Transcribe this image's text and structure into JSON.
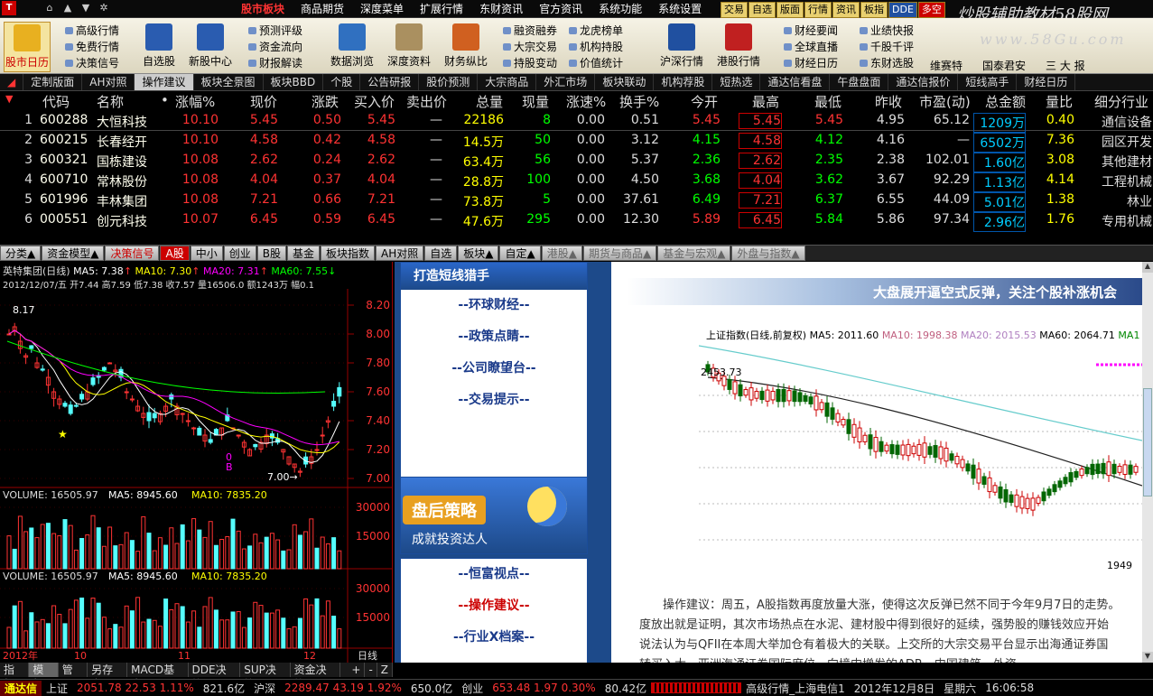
{
  "titlebar": {
    "nav_icons": [
      "home-icon",
      "up-arrow-icon",
      "down-arrow-icon",
      "star-icon"
    ],
    "menu": [
      "股市板块",
      "商品期货",
      "深度菜单",
      "扩展行情",
      "东财资讯",
      "官方资讯",
      "系统功能",
      "系统设置"
    ],
    "quick": [
      "交易",
      "自选",
      "版面",
      "行情",
      "资讯",
      "板指",
      "DDE",
      "多空"
    ],
    "watermark": "炒股辅助教材58股网",
    "watermark2": "www.58Gu.com"
  },
  "toolbar": {
    "big": [
      {
        "label": "股市日历",
        "icon": "calendar-icon",
        "color": "#e8b020"
      },
      {
        "label": "自选股",
        "icon": "chart-icon",
        "color": "#2a5cb0"
      },
      {
        "label": "新股中心",
        "icon": "chart-icon",
        "color": "#2a5cb0"
      },
      {
        "label": "数据浏览",
        "icon": "monitor-icon",
        "color": "#3070c0"
      },
      {
        "label": "深度资料",
        "icon": "document-icon",
        "color": "#aa9060"
      },
      {
        "label": "财务纵比",
        "icon": "bar-chart-icon",
        "color": "#d06020"
      },
      {
        "label": "沪深行情",
        "icon": "flag-icon",
        "color": "#2050a0"
      },
      {
        "label": "港股行情",
        "icon": "flag-icon",
        "color": "#c02020"
      }
    ],
    "col1": [
      "高级行情",
      "免费行情",
      "决策信号"
    ],
    "col2": [
      "预测评级",
      "资金流向",
      "财报解读"
    ],
    "col3": [
      "融资融券",
      "大宗交易",
      "持股变动"
    ],
    "col4": [
      "龙虎榜单",
      "机构持股",
      "价值统计"
    ],
    "col5": [
      "财经要闻",
      "全球直播",
      "财经日历"
    ],
    "col6": [
      "业绩快报",
      "千股千评",
      "东财选股"
    ],
    "right": [
      "维赛特",
      "国泰君安",
      "三 大 报"
    ]
  },
  "cattabs": [
    "定制版面",
    "AH对照",
    "操作建议",
    "板块全景图",
    "板块BBD",
    "个股",
    "公告研报",
    "股价预测",
    "大宗商品",
    "外汇市场",
    "板块联动",
    "机构荐股",
    "短热选",
    "通达信看盘",
    "午盘盘面",
    "通达信报价",
    "短线高手",
    "财经日历"
  ],
  "quotes": {
    "headers": [
      "代码",
      "名称",
      "•",
      "涨幅%",
      "现价",
      "涨跌",
      "买入价",
      "卖出价",
      "总量",
      "现量",
      "涨速%",
      "换手%",
      "今开",
      "最高",
      "最低",
      "昨收",
      "市盈(动)",
      "总金额",
      "量比",
      "细分行业"
    ],
    "rows": [
      {
        "idx": "1",
        "code": "600288",
        "name": "大恒科技",
        "rate": "10.10",
        "price": "5.45",
        "chg": "0.50",
        "bid": "5.45",
        "ask": "—",
        "vol": "22186",
        "cur": "8",
        "spd": "0.00",
        "turn": "0.51",
        "open": "5.45",
        "open_color": "#f33",
        "high": "5.45",
        "low": "5.45",
        "low_color": "#f33",
        "prev": "4.95",
        "pe": "65.12",
        "amt": "1209万",
        "ratio": "0.40",
        "ind": "通信设备"
      },
      {
        "idx": "2",
        "code": "600215",
        "name": "长春经开",
        "rate": "10.10",
        "price": "4.58",
        "chg": "0.42",
        "bid": "4.58",
        "ask": "—",
        "vol": "14.5万",
        "cur": "50",
        "spd": "0.00",
        "turn": "3.12",
        "open": "4.15",
        "open_color": "#0f0",
        "high": "4.58",
        "low": "4.12",
        "low_color": "#0f0",
        "prev": "4.16",
        "pe": "—",
        "amt": "6502万",
        "ratio": "7.36",
        "ind": "园区开发"
      },
      {
        "idx": "3",
        "code": "600321",
        "name": "国栋建设",
        "rate": "10.08",
        "price": "2.62",
        "chg": "0.24",
        "bid": "2.62",
        "ask": "—",
        "vol": "63.4万",
        "cur": "56",
        "spd": "0.00",
        "turn": "5.37",
        "open": "2.36",
        "open_color": "#0f0",
        "high": "2.62",
        "low": "2.35",
        "low_color": "#0f0",
        "prev": "2.38",
        "pe": "102.01",
        "amt": "1.60亿",
        "ratio": "3.08",
        "ind": "其他建材"
      },
      {
        "idx": "4",
        "code": "600710",
        "name": "常林股份",
        "rate": "10.08",
        "price": "4.04",
        "chg": "0.37",
        "bid": "4.04",
        "ask": "—",
        "vol": "28.8万",
        "cur": "100",
        "spd": "0.00",
        "turn": "4.50",
        "open": "3.68",
        "open_color": "#0f0",
        "high": "4.04",
        "low": "3.62",
        "low_color": "#0f0",
        "prev": "3.67",
        "pe": "92.29",
        "amt": "1.13亿",
        "ratio": "4.14",
        "ind": "工程机械"
      },
      {
        "idx": "5",
        "code": "601996",
        "name": "丰林集团",
        "rate": "10.08",
        "price": "7.21",
        "chg": "0.66",
        "bid": "7.21",
        "ask": "—",
        "vol": "73.8万",
        "cur": "5",
        "spd": "0.00",
        "turn": "37.61",
        "open": "6.49",
        "open_color": "#0f0",
        "high": "7.21",
        "low": "6.37",
        "low_color": "#0f0",
        "prev": "6.55",
        "pe": "44.09",
        "amt": "5.01亿",
        "ratio": "1.38",
        "ind": "林业"
      },
      {
        "idx": "6",
        "code": "000551",
        "name": "创元科技",
        "rate": "10.07",
        "price": "6.45",
        "chg": "0.59",
        "bid": "6.45",
        "ask": "—",
        "vol": "47.6万",
        "cur": "295",
        "spd": "0.00",
        "turn": "12.30",
        "open": "5.89",
        "open_color": "#f33",
        "high": "6.45",
        "low": "5.84",
        "low_color": "#0f0",
        "prev": "5.86",
        "pe": "97.34",
        "amt": "2.96亿",
        "ratio": "1.76",
        "ind": "专用机械"
      }
    ]
  },
  "bottomtabs": [
    "分类▲",
    "资金模型▲",
    "决策信号",
    "A股",
    "中小",
    "创业",
    "B股",
    "基金",
    "板块指数",
    "AH对照",
    "自选",
    "板块▲",
    "自定▲",
    "港股▲",
    "期货与商品▲",
    "基金与宏观▲",
    "外盘与指数▲"
  ],
  "chart": {
    "title": "英特集团(日线)",
    "ma5": "MA5: 7.38",
    "ma10": "MA10: 7.30",
    "ma20": "MA20: 7.31",
    "ma60": "MA60: 7.55",
    "info": "2012/12/07/五 开7.44 高7.59 低7.38 收7.57 量16506.0 额1243万 幅0.1",
    "price_axis": [
      "8.20",
      "8.00",
      "7.80",
      "7.60",
      "7.40",
      "7.20",
      "7.00"
    ],
    "high_label": "8.17",
    "low_label": "7.00",
    "vol1": "VOLUME: 16505.97",
    "vol1_ma5": "MA5: 8945.60",
    "vol1_ma10": "MA10: 7835.20",
    "vol_axis": [
      "30000",
      "15000"
    ],
    "vol2": "VOLUME: 16505.97",
    "vol2_ma5": "MA5: 8945.60",
    "vol2_ma10": "MA10: 7835.20",
    "x_labels": [
      "2012年",
      "10",
      "11",
      "12"
    ],
    "period": "日线",
    "signal_b": "B",
    "signal_zero": "0"
  },
  "web": {
    "top_text": "打造短线猎手",
    "links1": [
      "--环球财经--",
      "--政策点睛--",
      "--公司瞭望台--",
      "--交易提示--"
    ],
    "banner_title": "盘后策略",
    "banner_sub": "成就投资达人",
    "links2": [
      "--恒富视点--",
      "--操作建议--",
      "--行业X档案--"
    ],
    "headline": "大盘展开逼空式反弹，关注个股补涨机会",
    "idx_title": "上证指数(日线,前复权)",
    "idx_ma5": "MA5: 2011.60",
    "idx_ma10": "MA10: 1998.38",
    "idx_ma20": "MA20: 2015.53",
    "idx_ma60": "MA60: 2064.71",
    "idx_ma1": "MA1",
    "idx_high": "2453.73",
    "idx_low": "1949",
    "para1": "操作建议：周五，A股指数再度放量大涨，使得这次反弹已然不同于今年9月7日的走势。",
    "para2": "度放出就是证明，其次市场热点在水泥、建材股中得到很好的延续，强势股的赚钱效应开始",
    "para3": "说法认为与QFII在本周大举加仓有着极大的关联。上交所的大宗交易平台显示出海通证券国",
    "para4": "转买入大…亚洲海通证券国际席位…向境内增发的ADR…中国建筑…外资…一…"
  },
  "leftfoot": [
    "指标",
    "模板",
    "管理",
    "另存为",
    "MACD基本",
    "DDE决策",
    "SUP决策",
    "资金决策"
  ],
  "leftfoot_right": [
    "+",
    "-",
    "Z"
  ],
  "ticker": {
    "app": "通达信",
    "sh_label": "上证",
    "sh_val": "2051.78  22.53  1.11%",
    "sh_amt": "821.6亿",
    "sz_label": "沪深",
    "sz_val": "2289.47  43.19  1.92%",
    "sz_amt": "650.0亿",
    "cy_label": "创业",
    "cy_val": "653.48  1.97  0.30%",
    "cy_amt": "80.42亿",
    "feed": "高级行情_上海电信1",
    "date": "2012年12月8日",
    "weekday": "星期六",
    "time": "16:06:58"
  }
}
